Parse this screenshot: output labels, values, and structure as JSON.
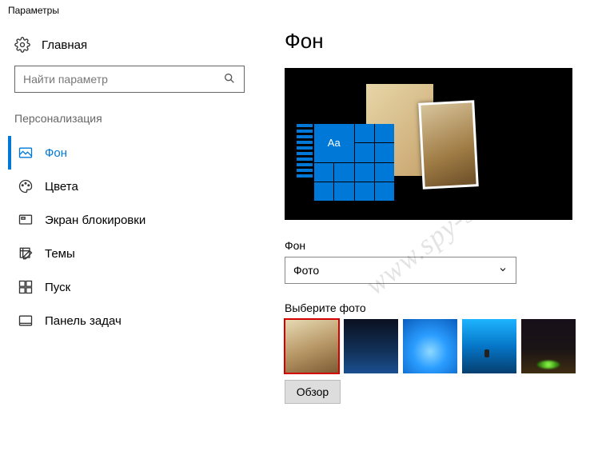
{
  "window": {
    "title": "Параметры"
  },
  "home": {
    "label": "Главная"
  },
  "search": {
    "placeholder": "Найти параметр"
  },
  "section": {
    "label": "Персонализация"
  },
  "nav": {
    "items": [
      {
        "label": "Фон",
        "icon": "picture-icon",
        "active": true
      },
      {
        "label": "Цвета",
        "icon": "palette-icon",
        "active": false
      },
      {
        "label": "Экран блокировки",
        "icon": "lockscreen-icon",
        "active": false
      },
      {
        "label": "Темы",
        "icon": "themes-icon",
        "active": false
      },
      {
        "label": "Пуск",
        "icon": "start-icon",
        "active": false
      },
      {
        "label": "Панель задач",
        "icon": "taskbar-icon",
        "active": false
      }
    ]
  },
  "page": {
    "title": "Фон"
  },
  "preview": {
    "sample_text": "Aa"
  },
  "background_select": {
    "label": "Фон",
    "value": "Фото"
  },
  "choose_photo": {
    "label": "Выберите фото"
  },
  "browse": {
    "label": "Обзор"
  },
  "watermark": {
    "text": "www.spy-soft.net"
  }
}
